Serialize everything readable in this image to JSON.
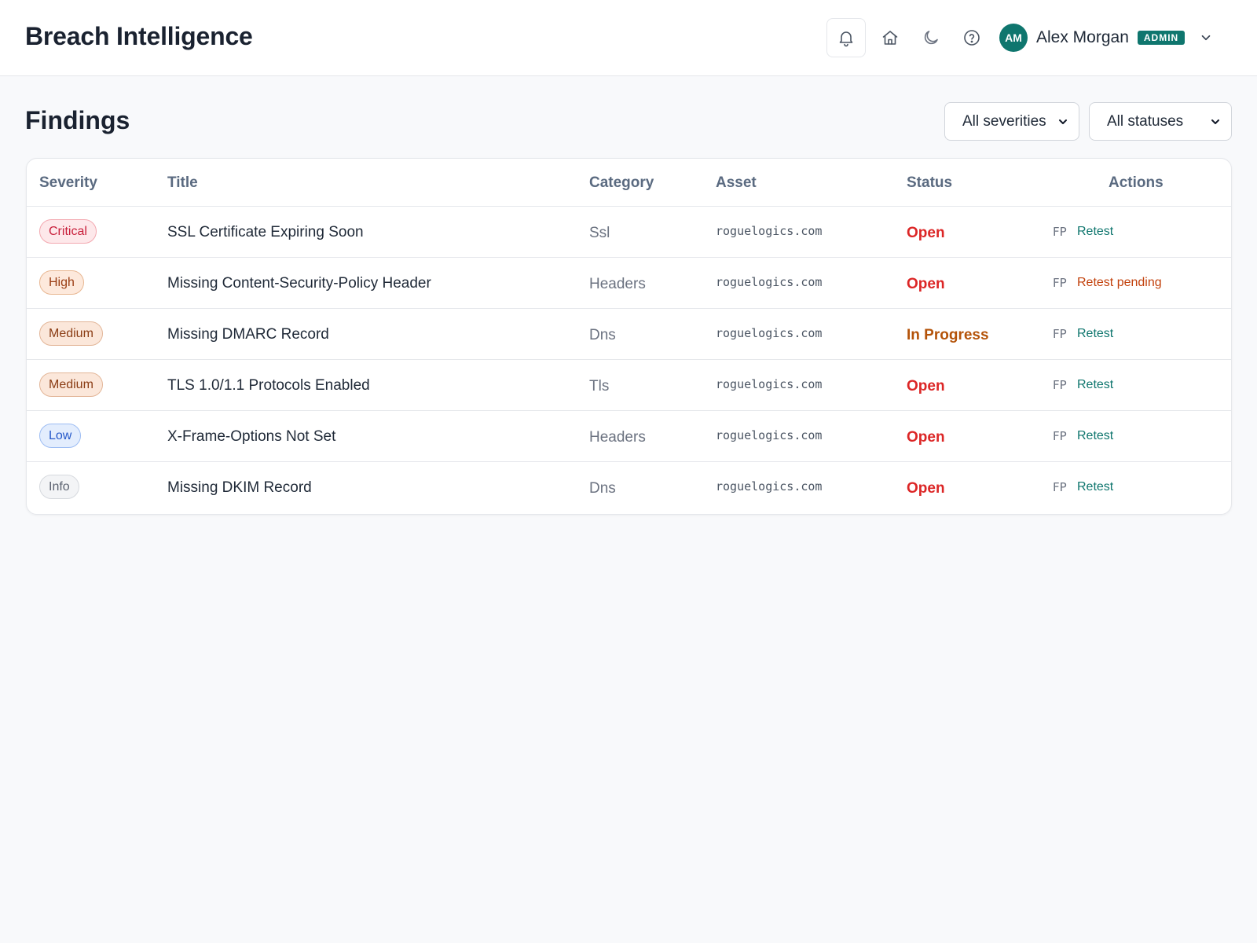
{
  "app": {
    "title": "Breach Intelligence"
  },
  "header": {
    "icons": [
      "bell-icon",
      "home-icon",
      "moon-icon",
      "help-icon",
      "chevron-down-icon"
    ],
    "user": {
      "initials": "AM",
      "name": "Alex Morgan",
      "role": "ADMIN"
    }
  },
  "page": {
    "title": "Findings",
    "filters": {
      "severity": "All severities",
      "status": "All statuses"
    }
  },
  "table": {
    "columns": [
      "Severity",
      "Title",
      "Category",
      "Asset",
      "Status",
      "Actions"
    ],
    "rows": [
      {
        "severity": "Critical",
        "title": "SSL Certificate Expiring Soon",
        "category": "Ssl",
        "asset": "roguelogics.com",
        "status": "Open",
        "fp": "FP",
        "action": "Retest"
      },
      {
        "severity": "High",
        "title": "Missing Content-Security-Policy Header",
        "category": "Headers",
        "asset": "roguelogics.com",
        "status": "Open",
        "fp": "FP",
        "action": "Retest pending"
      },
      {
        "severity": "Medium",
        "title": "Missing DMARC Record",
        "category": "Dns",
        "asset": "roguelogics.com",
        "status": "In Progress",
        "fp": "FP",
        "action": "Retest"
      },
      {
        "severity": "Medium",
        "title": "TLS 1.0/1.1 Protocols Enabled",
        "category": "Tls",
        "asset": "roguelogics.com",
        "status": "Open",
        "fp": "FP",
        "action": "Retest"
      },
      {
        "severity": "Low",
        "title": "X-Frame-Options Not Set",
        "category": "Headers",
        "asset": "roguelogics.com",
        "status": "Open",
        "fp": "FP",
        "action": "Retest"
      },
      {
        "severity": "Info",
        "title": "Missing DKIM Record",
        "category": "Dns",
        "asset": "roguelogics.com",
        "status": "Open",
        "fp": "FP",
        "action": "Retest"
      }
    ]
  },
  "colors": {
    "accent": "#0f766e",
    "status_open": "#dc2626",
    "status_in_progress": "#b45309",
    "action_retest": "#0f766e",
    "action_pending": "#c2410c",
    "severity": {
      "Critical": {
        "bg": "#fde8ea",
        "border": "#f3a8b0",
        "text": "#c81e3a"
      },
      "High": {
        "bg": "#fde9dc",
        "border": "#e8b792",
        "text": "#9a3c12"
      },
      "Medium": {
        "bg": "#fbe7da",
        "border": "#e2b597",
        "text": "#8a3c14"
      },
      "Low": {
        "bg": "#e3edfd",
        "border": "#9cbcf3",
        "text": "#2558c9"
      },
      "Info": {
        "bg": "#f3f4f6",
        "border": "#d6d9de",
        "text": "#5b6270"
      }
    }
  }
}
